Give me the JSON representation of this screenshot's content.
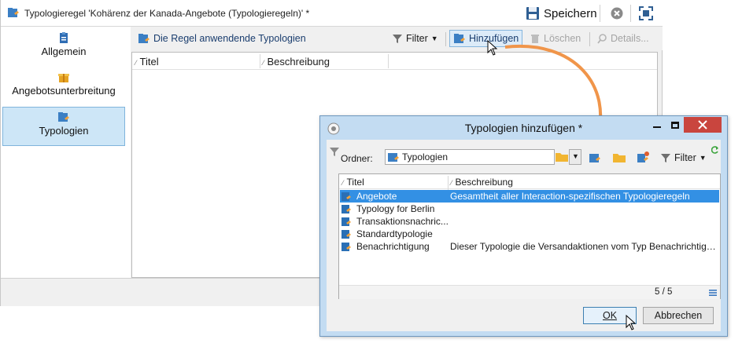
{
  "window": {
    "title": "Typologieregel 'Kohärenz der Kanada-Angebote (Typologieregeln)' *",
    "save_label": "Speichern"
  },
  "sidebar": {
    "items": [
      {
        "label": "Allgemein",
        "icon": "clipboard-icon"
      },
      {
        "label": "Angebotsunterbreitung",
        "icon": "gift-icon"
      },
      {
        "label": "Typologien",
        "icon": "typology-icon",
        "selected": true
      }
    ]
  },
  "toolbar": {
    "typologies_link": "Die Regel anwendende Typologien",
    "filter": "Filter",
    "add": "Hinzufügen",
    "delete": "Löschen",
    "details": "Details..."
  },
  "main_list": {
    "columns": [
      "Titel",
      "Beschreibung"
    ]
  },
  "dialog": {
    "title": "Typologien hinzufügen *",
    "folder_label": "Ordner:",
    "folder_value": "Typologien",
    "filter": "Filter",
    "columns": [
      "Titel",
      "Beschreibung"
    ],
    "rows": [
      {
        "title": "Angebote",
        "description": "Gesamtheit aller Interaction-spezifischen Typologieregeln",
        "selected": true
      },
      {
        "title": "Typology for Berlin",
        "description": ""
      },
      {
        "title": "Transaktionsnachric...",
        "description": ""
      },
      {
        "title": "Standardtypologie",
        "description": ""
      },
      {
        "title": "Benachrichtigung",
        "description": "Dieser Typologie die Versandaktionen vom Typ Benachrichtigu..."
      }
    ],
    "count": "5 / 5",
    "ok": "OK",
    "cancel": "Abbrechen"
  },
  "colors": {
    "accent": "#3390e4",
    "arrow": "#f0954a",
    "close": "#c9453e"
  }
}
